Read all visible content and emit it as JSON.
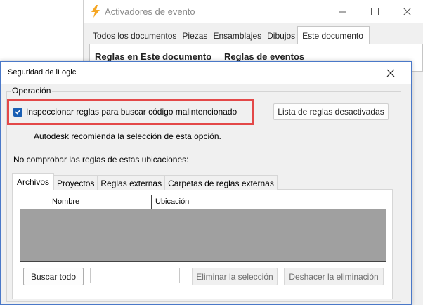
{
  "background_window": {
    "title": "Activadores de evento",
    "tabs": [
      {
        "label": "Todos los documentos"
      },
      {
        "label": "Piezas"
      },
      {
        "label": "Ensamblajes"
      },
      {
        "label": "Dibujos"
      },
      {
        "label": "Este documento",
        "active": true
      }
    ],
    "columns": [
      "Reglas en Este documento",
      "Reglas de eventos"
    ],
    "icon": "lightning-bolt-icon",
    "icon_color": "#f5a623"
  },
  "dialog": {
    "title": "Seguridad de iLogic",
    "group_label": "Operación",
    "checkbox": {
      "label": "Inspeccionar reglas para buscar código malintencionado",
      "checked": true
    },
    "disabled_rules_button": "Lista de reglas desactivadas",
    "note": "Autodesk recomienda la selección de esta opción.",
    "locations_label": "No comprobar las reglas de estas ubicaciones:",
    "tabs": [
      {
        "label": "Archivos",
        "active": true
      },
      {
        "label": "Proyectos"
      },
      {
        "label": "Reglas externas"
      },
      {
        "label": "Carpetas de reglas externas"
      }
    ],
    "grid_columns": [
      "",
      "Nombre",
      "Ubicación"
    ],
    "browse_button": "Buscar todo",
    "path_input_value": "",
    "remove_button": "Eliminar la selección",
    "undo_button": "Deshacer la eliminación"
  },
  "colors": {
    "accent": "#1a5fb4",
    "highlight": "#e34848",
    "dialog_border": "#4a78c8"
  }
}
